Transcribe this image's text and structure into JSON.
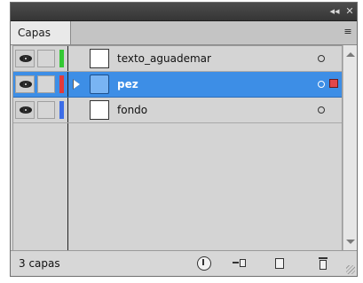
{
  "window": {
    "collapse_icon": "◂◂",
    "close_icon": "✕"
  },
  "panel": {
    "tab_label": "Capas",
    "menu_icon": "≡"
  },
  "layers": [
    {
      "name": "texto_aguademar",
      "color": "#34c934",
      "selected": false,
      "has_children": false,
      "thumb": "white"
    },
    {
      "name": "pez",
      "color": "#e33a3a",
      "selected": true,
      "has_children": true,
      "thumb": "blue"
    },
    {
      "name": "fondo",
      "color": "#3d6de8",
      "selected": false,
      "has_children": false,
      "thumb": "white"
    }
  ],
  "footer": {
    "count_label": "3 capas"
  },
  "colors": {
    "selection": "#3d8ee6",
    "topbar": "#3e3e3e",
    "panel_bg": "#d7d7d7"
  }
}
